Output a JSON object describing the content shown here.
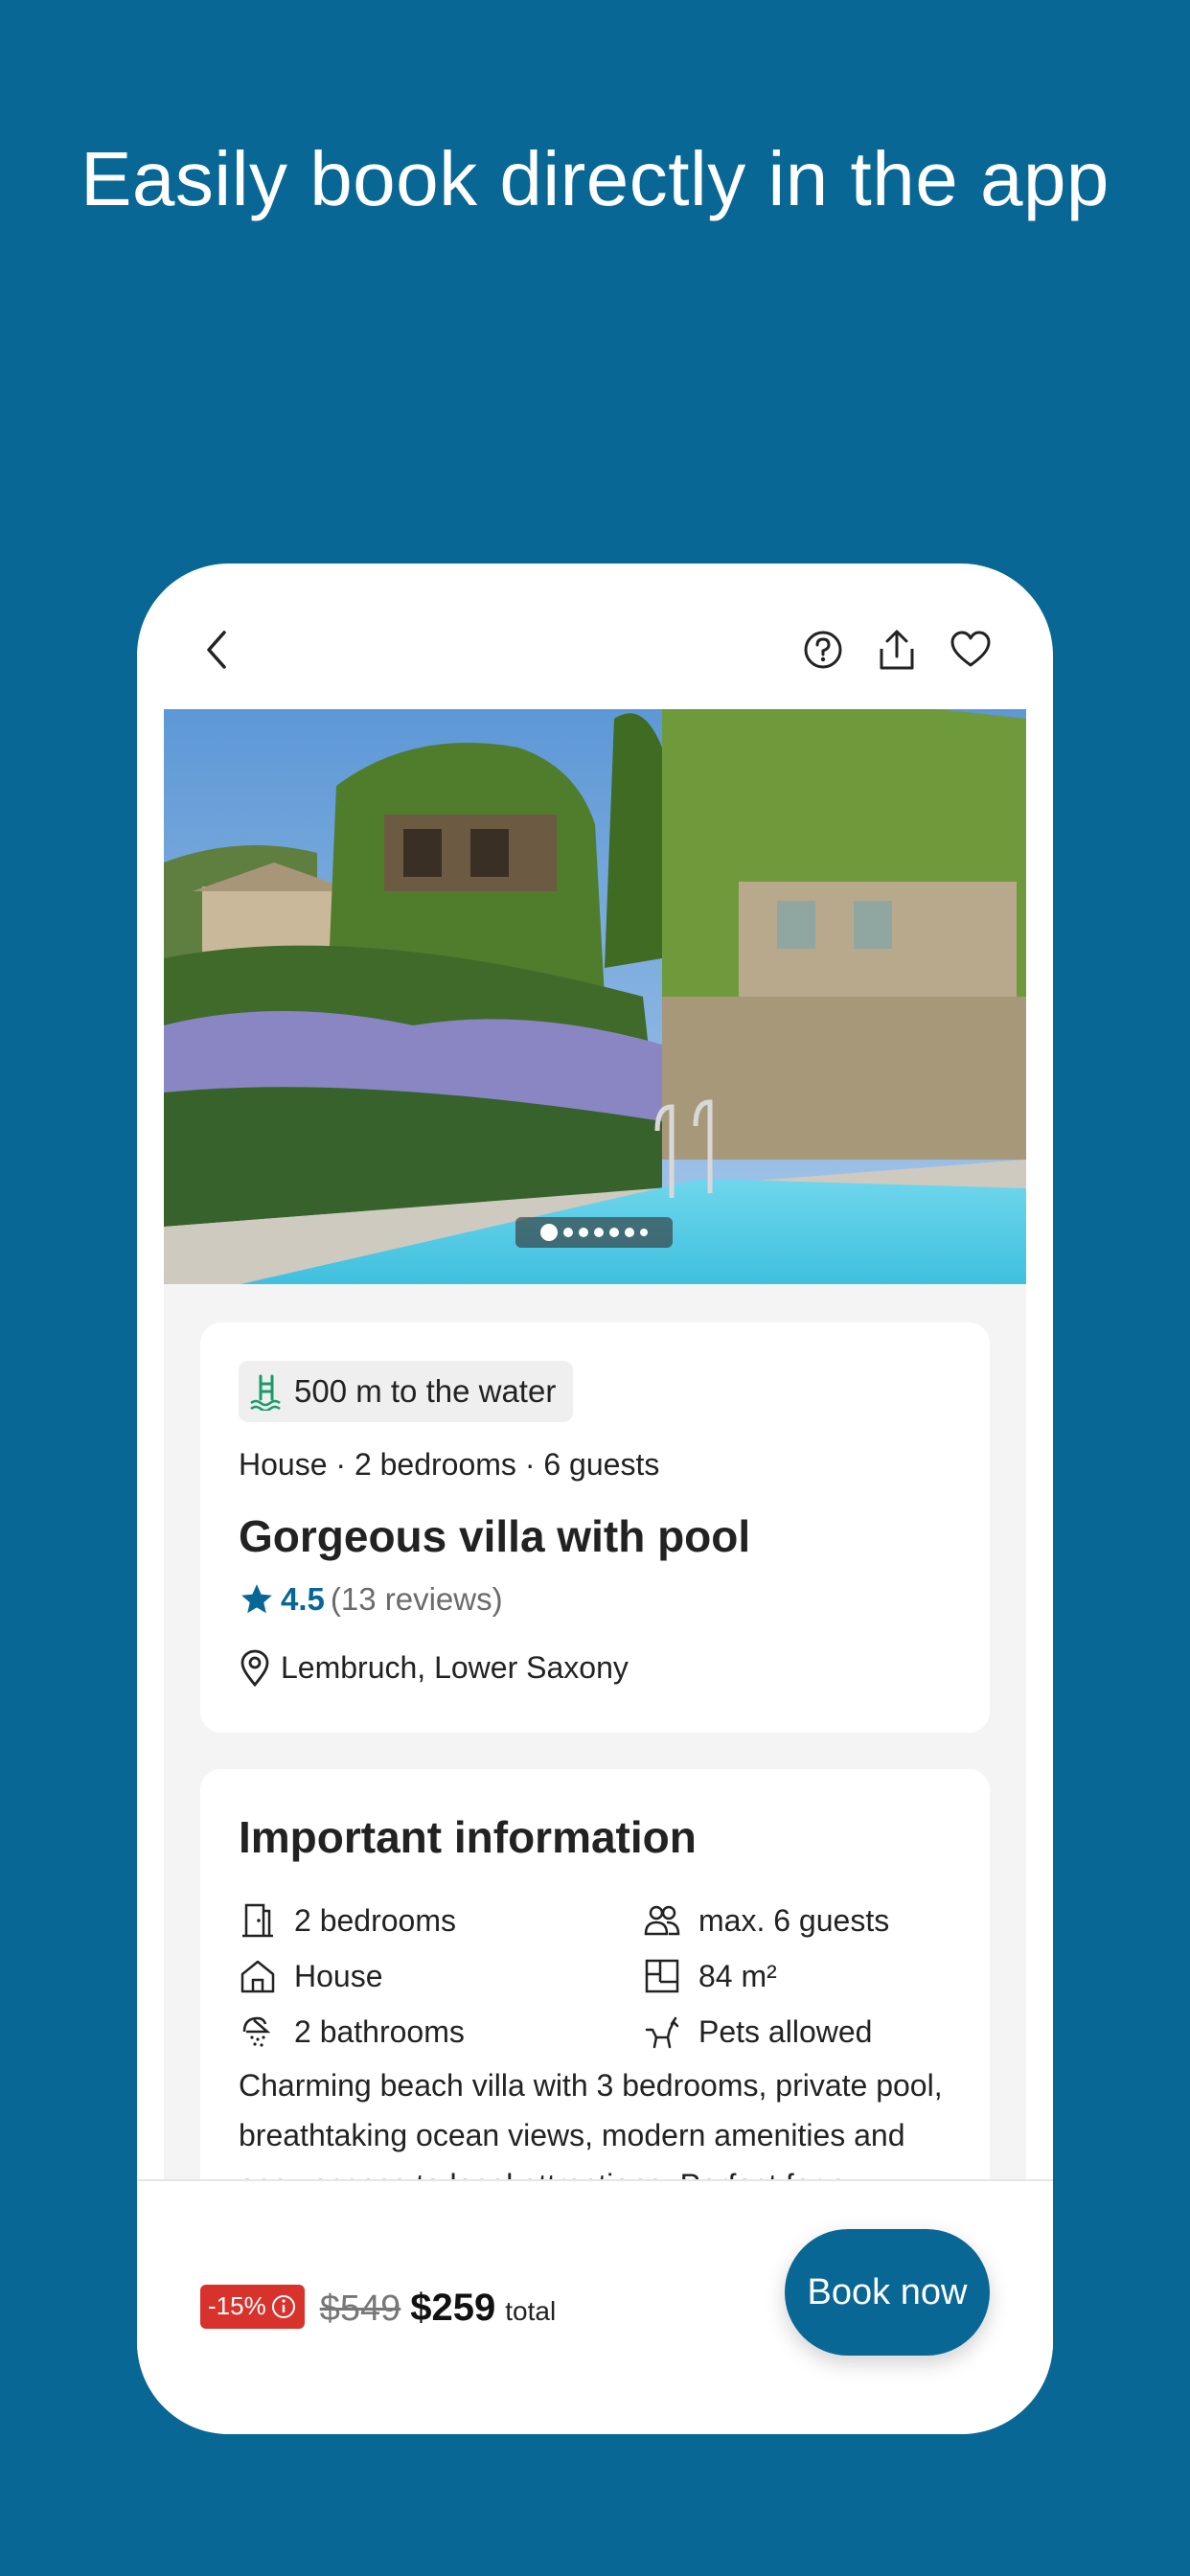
{
  "headline": "Easily book directly in the app",
  "topbar": {
    "back_icon": "chevron-left-icon",
    "help_icon": "question-circle-icon",
    "share_icon": "share-icon",
    "favorite_icon": "heart-icon"
  },
  "gallery": {
    "image_count": 7,
    "active_index": 0
  },
  "listing": {
    "chip_text": "500 m to the water",
    "meta": "House · 2 bedrooms · 6 guests",
    "title": "Gorgeous villa with pool",
    "rating": "4.5",
    "reviews": "(13 reviews)",
    "location": "Lembruch, Lower Saxony"
  },
  "important": {
    "title": "Important information",
    "features": [
      {
        "icon": "door-icon",
        "label": "2 bedrooms"
      },
      {
        "icon": "guests-icon",
        "label": "max. 6 guests"
      },
      {
        "icon": "house-icon",
        "label": "House"
      },
      {
        "icon": "floorplan-icon",
        "label": "84 m²"
      },
      {
        "icon": "shower-icon",
        "label": "2 bathrooms"
      },
      {
        "icon": "pet-icon",
        "label": "Pets allowed"
      }
    ],
    "description": "Charming beach villa with 3 bedrooms, private pool, breathtaking ocean views, modern amenities and easy access to local attractions. Perfect for a"
  },
  "pricing": {
    "discount": "-15%",
    "old_price": "$549",
    "new_price": "$259",
    "total_label": "total",
    "book_label": "Book now"
  },
  "colors": {
    "brand": "#086795",
    "discount": "#d7322c"
  }
}
